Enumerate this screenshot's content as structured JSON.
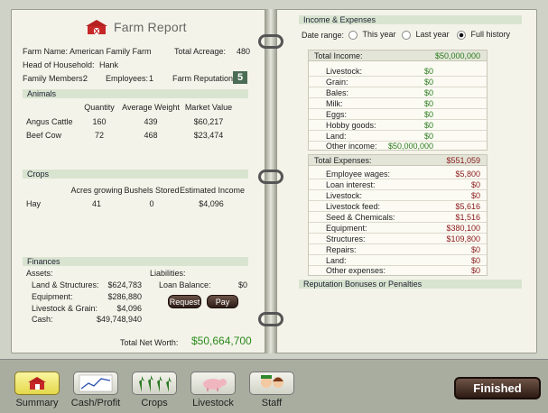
{
  "report": {
    "title": "Farm Report",
    "farm_name_label": "Farm Name:",
    "farm_name": "American Family Farm",
    "acreage_label": "Total Acreage:",
    "acreage": "480",
    "head_label": "Head of Household:",
    "head": "Hank",
    "members_label": "Family Members:",
    "members": "2",
    "employees_label": "Employees:",
    "employees": "1",
    "reputation_label": "Farm Reputation:",
    "reputation": "5"
  },
  "animals": {
    "header": "Animals",
    "columns": [
      "Quantity",
      "Average Weight",
      "Market Value"
    ],
    "rows": [
      {
        "name": "Angus Cattle",
        "quantity": "160",
        "weight": "439",
        "value": "$60,217"
      },
      {
        "name": "Beef Cow",
        "quantity": "72",
        "weight": "468",
        "value": "$23,474"
      }
    ]
  },
  "crops": {
    "header": "Crops",
    "columns": [
      "Acres growing",
      "Bushels Stored",
      "Estimated Income"
    ],
    "rows": [
      {
        "name": "Hay",
        "acres": "41",
        "bushels": "0",
        "income": "$4,096"
      }
    ]
  },
  "finances": {
    "header": "Finances",
    "assets_label": "Assets:",
    "assets": [
      {
        "label": "Land & Structures:",
        "value": "$624,783"
      },
      {
        "label": "Equipment:",
        "value": "$286,880"
      },
      {
        "label": "Livestock & Grain:",
        "value": "$4,096"
      },
      {
        "label": "Cash:",
        "value": "$49,748,940"
      }
    ],
    "liabilities_label": "Liabilities:",
    "loan_label": "Loan Balance:",
    "loan_value": "$0",
    "request_label": "Request",
    "pay_label": "Pay",
    "networth_label": "Total Net Worth:",
    "networth": "$50,664,700"
  },
  "income_expenses": {
    "header": "Income & Expenses",
    "date_range_label": "Date range:",
    "options": [
      "This year",
      "Last year",
      "Full history"
    ],
    "selected": "Full history",
    "total_income_label": "Total Income:",
    "total_income": "$50,000,000",
    "income_rows": [
      {
        "label": "Livestock:",
        "value": "$0"
      },
      {
        "label": "Grain:",
        "value": "$0"
      },
      {
        "label": "Bales:",
        "value": "$0"
      },
      {
        "label": "Milk:",
        "value": "$0"
      },
      {
        "label": "Eggs:",
        "value": "$0"
      },
      {
        "label": "Hobby goods:",
        "value": "$0"
      },
      {
        "label": "Land:",
        "value": "$0"
      },
      {
        "label": "Other income:",
        "value": "$50,000,000"
      }
    ],
    "total_expenses_label": "Total Expenses:",
    "total_expenses": "$551,059",
    "expense_rows": [
      {
        "label": "Employee wages:",
        "value": "$5,800"
      },
      {
        "label": "Loan interest:",
        "value": "$0"
      },
      {
        "label": "Livestock:",
        "value": "$0"
      },
      {
        "label": "Livestock feed:",
        "value": "$5,616"
      },
      {
        "label": "Seed & Chemicals:",
        "value": "$1,516"
      },
      {
        "label": "Equipment:",
        "value": "$380,100"
      },
      {
        "label": "Structures:",
        "value": "$109,800"
      },
      {
        "label": "Repairs:",
        "value": "$0"
      },
      {
        "label": "Land:",
        "value": "$0"
      },
      {
        "label": "Other expenses:",
        "value": "$0"
      }
    ],
    "reputation_header": "Reputation Bonuses or Penalties"
  },
  "toolbar": {
    "tabs": [
      "Summary",
      "Cash/Profit",
      "Crops",
      "Livestock",
      "Staff"
    ],
    "active": "Summary",
    "finished_label": "Finished"
  },
  "colors": {
    "income": "#2a7b1c",
    "expense": "#8a1a1a",
    "networth": "#2a8a1c",
    "section": "#d8e4d0"
  }
}
